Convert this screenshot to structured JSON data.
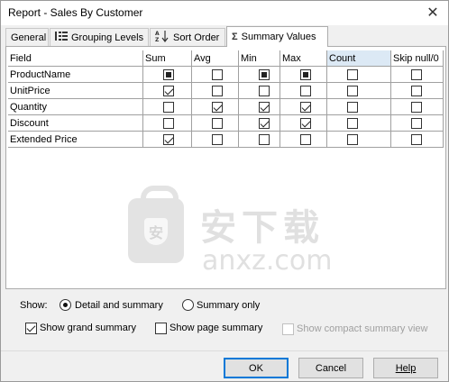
{
  "window": {
    "title": "Report - Sales By Customer",
    "close_glyph": "✕"
  },
  "tabs": [
    {
      "label": "General",
      "icon": "",
      "active": false
    },
    {
      "label": "Grouping Levels",
      "icon": "grouping-levels-icon",
      "active": false
    },
    {
      "label": "Sort Order",
      "icon": "sort-az-icon",
      "active": false
    },
    {
      "label": "Summary Values",
      "icon": "sigma-icon",
      "active": true
    }
  ],
  "grid": {
    "headers": [
      "Field",
      "Sum",
      "Avg",
      "Min",
      "Max",
      "Count",
      "Skip null/0"
    ],
    "highlight_header": "Count",
    "rows": [
      {
        "field": "ProductName",
        "states": [
          "filled",
          "empty",
          "filled",
          "filled",
          "empty",
          "empty"
        ]
      },
      {
        "field": "UnitPrice",
        "states": [
          "checked",
          "empty",
          "empty",
          "empty",
          "empty",
          "empty"
        ]
      },
      {
        "field": "Quantity",
        "states": [
          "empty",
          "checked",
          "checked",
          "checked",
          "empty",
          "empty"
        ]
      },
      {
        "field": "Discount",
        "states": [
          "empty",
          "empty",
          "checked",
          "checked",
          "empty",
          "empty"
        ]
      },
      {
        "field": "Extended Price",
        "states": [
          "checked",
          "empty",
          "empty",
          "empty",
          "empty",
          "empty"
        ]
      }
    ]
  },
  "watermark": {
    "cn_text": "安下载",
    "en_text": "anxz.com",
    "badge_glyph": "安"
  },
  "show": {
    "label": "Show:",
    "option_detail": "Detail and summary",
    "option_summary": "Summary only",
    "selected": "detail"
  },
  "checks": {
    "grand_summary": {
      "label": "Show grand summary",
      "checked": true
    },
    "page_summary": {
      "label": "Show page summary",
      "checked": false
    },
    "compact_summary": {
      "label": "Show compact summary view",
      "checked": false,
      "disabled": true
    }
  },
  "buttons": {
    "ok": "OK",
    "cancel": "Cancel",
    "help": "Help"
  },
  "colors": {
    "accent": "#0078d7",
    "header_highlight": "#dce9f5"
  }
}
